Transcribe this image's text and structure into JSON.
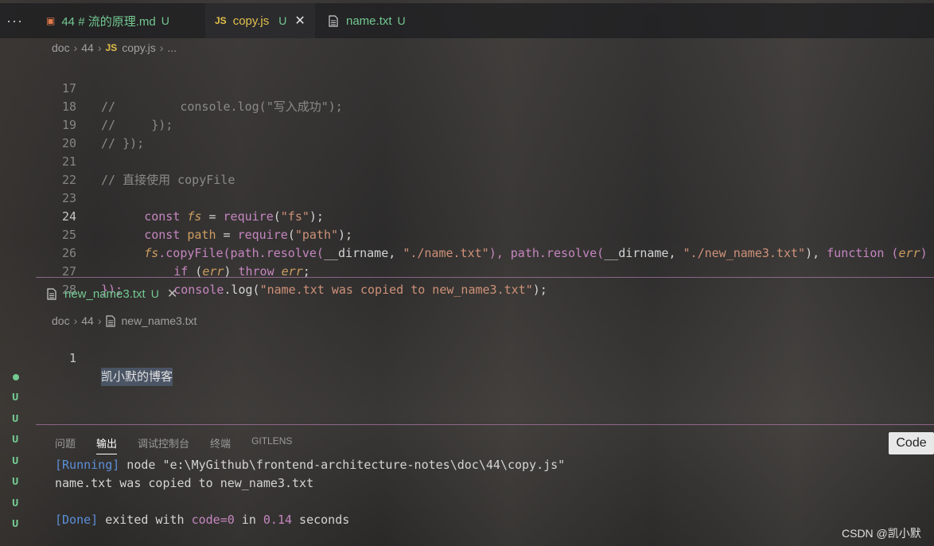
{
  "tabs": [
    {
      "icon": "markdown-icon",
      "label": "44 # 流的原理.md",
      "status": "U",
      "active": false
    },
    {
      "icon": "js-icon",
      "icon_text": "JS",
      "label": "copy.js",
      "status": "U",
      "active": true
    },
    {
      "icon": "file-icon",
      "label": "name.txt",
      "status": "U",
      "active": false
    }
  ],
  "more_label": "···",
  "breadcrumb": {
    "parts": [
      "doc",
      "44"
    ],
    "file": "copy.js",
    "tail": "..."
  },
  "code": {
    "lines": [
      {
        "num": "17",
        "text": "//         console.log(\"写入成功\");"
      },
      {
        "num": "18",
        "text": "//     });"
      },
      {
        "num": "19",
        "text": "// });"
      },
      {
        "num": "20",
        "text": ""
      },
      {
        "num": "21",
        "text": "// 直接使用 copyFile"
      },
      {
        "num": "22",
        "kw": "const",
        "var": "fs",
        "rest_a": " = ",
        "fn": "require",
        "rest_b": "(",
        "str": "\"fs\"",
        "rest_c": ");"
      },
      {
        "num": "23",
        "kw": "const",
        "var": "path",
        "rest_a": " = ",
        "fn": "require",
        "rest_b": "(",
        "str": "\"path\"",
        "rest_c": ");"
      },
      {
        "num": "24",
        "a": "fs",
        "b": ".copyFile(path.resolve(",
        "c": "__dirname, ",
        "d": "\"./name.txt\"",
        "e": "), path.resolve(",
        "f": "__dirname, ",
        "g": "\"./new_name3.txt\"",
        "h": "), ",
        "i": "function",
        "j": " (",
        "k": "err",
        "l": ") {"
      },
      {
        "num": "25",
        "a": "if",
        "b": " (",
        "c": "err",
        "d": ") ",
        "e": "throw",
        "f": " ",
        "g": "err",
        "h": ";"
      },
      {
        "num": "26",
        "a": "console",
        "b": ".log(",
        "c": "\"name.txt was copied to new_name3.txt\"",
        "d": ");"
      },
      {
        "num": "27",
        "text": "});"
      },
      {
        "num": "28",
        "text": ""
      }
    ]
  },
  "second_editor": {
    "tab_label": "new_name3.txt",
    "tab_status": "U",
    "breadcrumb": {
      "parts": [
        "doc",
        "44"
      ],
      "file": "new_name3.txt"
    },
    "line_num": "1",
    "content": "凯小默的博客"
  },
  "sidebar_status": [
    "U",
    "U",
    "U",
    "U",
    "U",
    "U",
    "U"
  ],
  "panel": {
    "tabs": [
      "问题",
      "输出",
      "调试控制台",
      "终端",
      "GITLENS"
    ],
    "active_tab": "输出",
    "code_button": "Code",
    "output": {
      "running_tag": "[Running]",
      "running_cmd": " node \"e:\\MyGithub\\frontend-architecture-notes\\doc\\44\\copy.js\"",
      "line2": "name.txt was copied to new_name3.txt",
      "done_tag": "[Done]",
      "done_a": " exited with ",
      "done_code": "code=0",
      "done_b": " in ",
      "done_time": "0.14",
      "done_c": " seconds"
    }
  },
  "watermark": "CSDN @凯小默"
}
